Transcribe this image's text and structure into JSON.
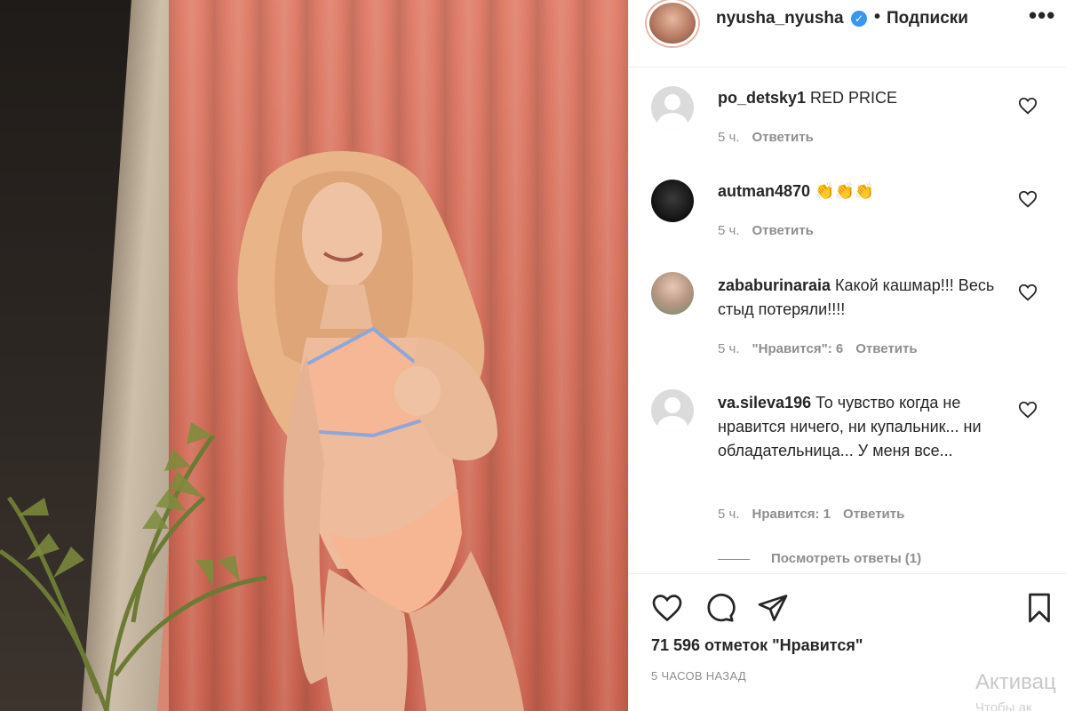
{
  "header": {
    "username": "nyusha_nyusha",
    "verified_glyph": "✓",
    "separator": "•",
    "follow_label": "Подписки",
    "more_glyph": "•••"
  },
  "comments": [
    {
      "user": "po_detsky1",
      "text": "RED PRICE",
      "time": "5 ч.",
      "likes": "",
      "reply": "Ответить",
      "avatar": "default-avatar"
    },
    {
      "user": "autman4870",
      "text": "👏👏👏",
      "time": "5 ч.",
      "likes": "",
      "reply": "Ответить",
      "avatar": "dark-avatar"
    },
    {
      "user": "zababurinaraia",
      "text": "Какой кашмар!!! Весь стыд потеряли!!!!",
      "time": "5 ч.",
      "likes": "\"Нравится\": 6",
      "reply": "Ответить",
      "avatar": "photo-avatar"
    },
    {
      "user": "va.sileva196",
      "text": "То чувство когда не нравится ничего, ни купальник... ни обладательница... У меня все...",
      "time": "5 ч.",
      "likes": "Нравится: 1",
      "reply": "Ответить",
      "avatar": "default-avatar"
    }
  ],
  "view_replies": "Посмотреть ответы (1)",
  "actions": {
    "like_icon": "heart-icon",
    "comment_icon": "comment-icon",
    "share_icon": "share-icon",
    "save_icon": "bookmark-icon"
  },
  "likes_text": "71 596 отметок \"Нравится\"",
  "time_ago": "5 ЧАСОВ НАЗАД",
  "watermark": {
    "line1": "Активац",
    "line2": "Чтобы ак"
  },
  "colors": {
    "verified": "#3897f0",
    "meta_text": "#8e8e8e",
    "curtain": "#d4715d"
  }
}
